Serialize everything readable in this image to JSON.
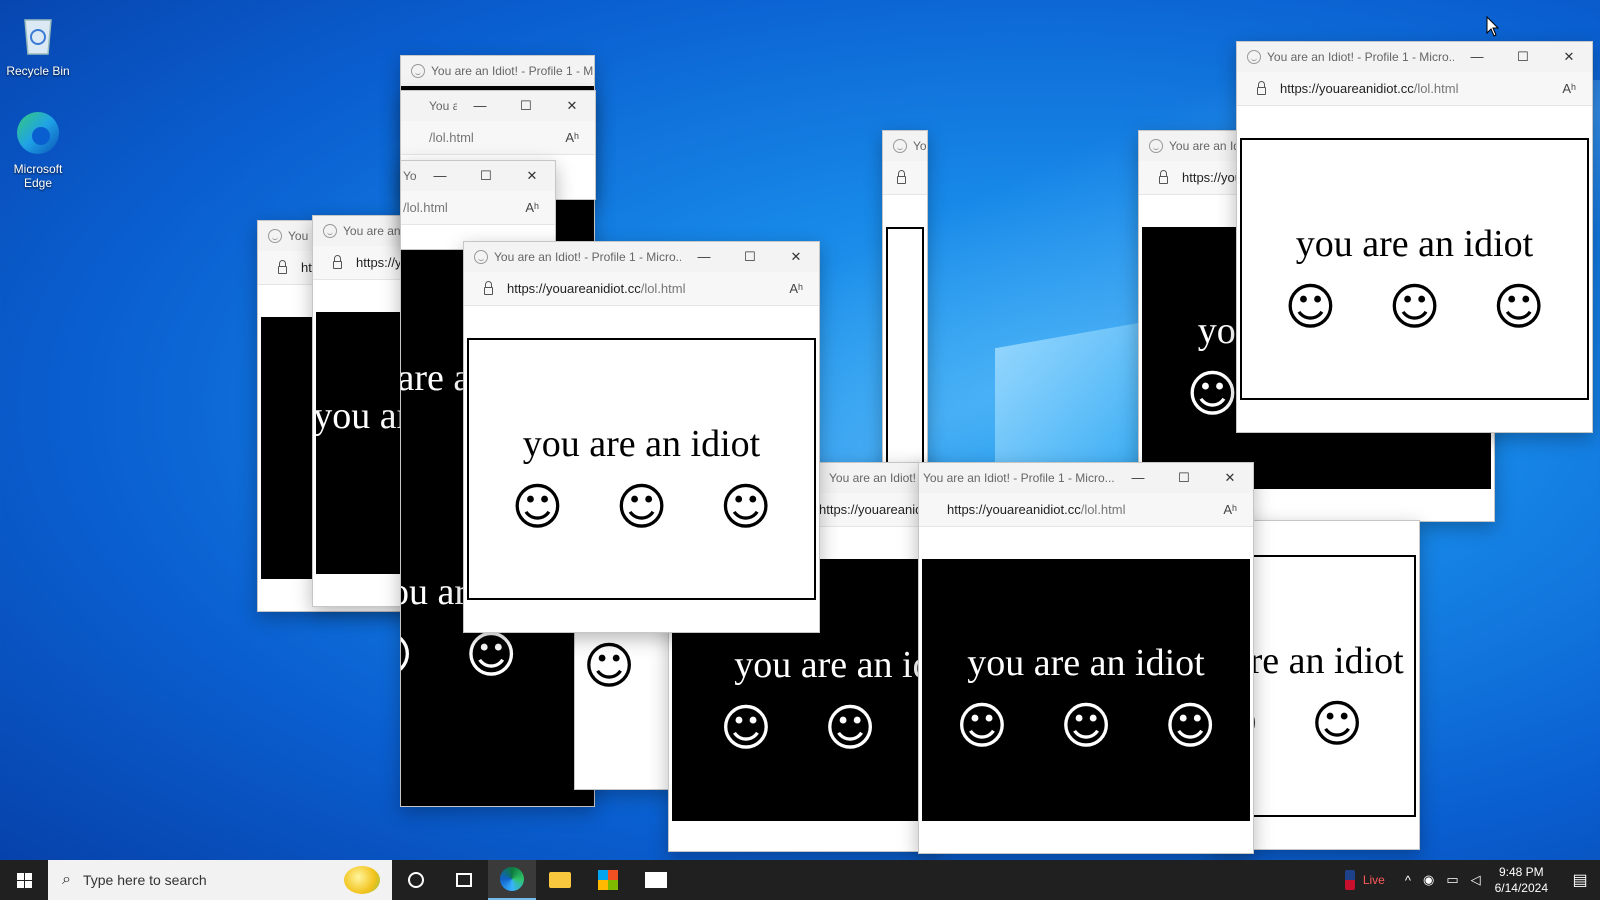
{
  "desktop": {
    "icons": [
      {
        "label": "Recycle Bin"
      },
      {
        "label": "Microsoft Edge"
      }
    ]
  },
  "popup": {
    "title": "You are an Idiot! - Profile 1 - Micro...",
    "title_short": "You are an Idiot! - Profile 1 - Micro...",
    "url_domain": "https://youareanidiot.cc",
    "url_path": "/lol.html",
    "message": "you are an idiot",
    "smiley": "☺",
    "reader_icon": "Aʰ",
    "min_glyph": "—",
    "max_glyph": "☐",
    "close_glyph": "✕"
  },
  "taskbar": {
    "search_placeholder": "Type here to search",
    "live_label": "Live",
    "time": "9:48 PM",
    "date": "6/14/2024"
  },
  "colors": {
    "taskbar": "#202020",
    "desktop_blue": "#1788e8"
  }
}
